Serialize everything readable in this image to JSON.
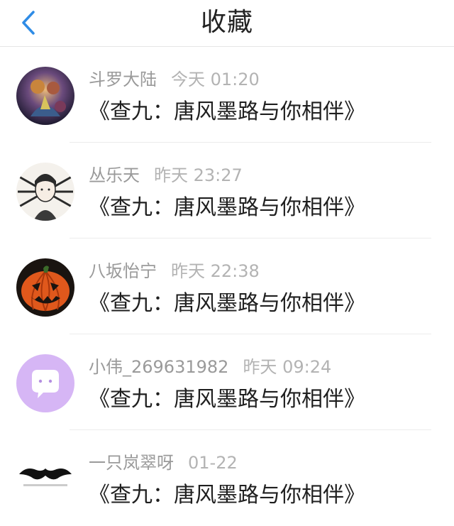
{
  "header": {
    "title": "收藏"
  },
  "items": [
    {
      "name": "斗罗大陆",
      "time": "今天 01:20",
      "text": "《查九：唐风墨路与你相伴》"
    },
    {
      "name": "丛乐天",
      "time": "昨天 23:27",
      "text": "《查九：唐风墨路与你相伴》"
    },
    {
      "name": "八坂怡宁",
      "time": "昨天 22:38",
      "text": "《查九：唐风墨路与你相伴》"
    },
    {
      "name": "小伟_269631982",
      "time": "昨天 09:24",
      "text": "《查九：唐风墨路与你相伴》"
    },
    {
      "name": "一只岚翠呀",
      "time": "01-22",
      "text": "《查九：唐风墨路与你相伴》"
    }
  ],
  "colors": {
    "accent": "#2f8ce6",
    "name_text": "#9a9a9a",
    "time_text": "#b3b3b3",
    "body_text": "#1f1f1f",
    "default_avatar_bg": "#d6b6f5"
  }
}
